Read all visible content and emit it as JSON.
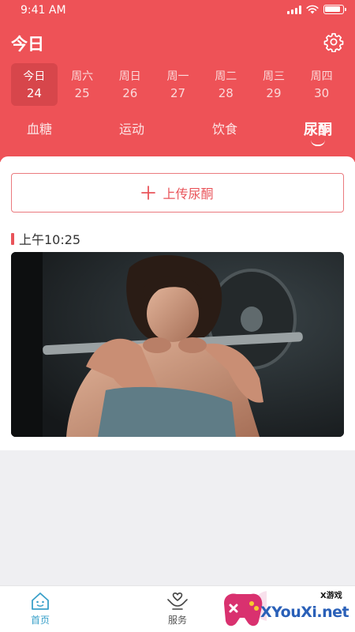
{
  "status_bar": {
    "time": "9:41 AM"
  },
  "header": {
    "title": "今日",
    "settings_icon": "gear-icon"
  },
  "days": [
    {
      "weekday": "今日",
      "date": "24",
      "active": true
    },
    {
      "weekday": "周六",
      "date": "25",
      "active": false
    },
    {
      "weekday": "周日",
      "date": "26",
      "active": false
    },
    {
      "weekday": "周一",
      "date": "27",
      "active": false
    },
    {
      "weekday": "周二",
      "date": "28",
      "active": false
    },
    {
      "weekday": "周三",
      "date": "29",
      "active": false
    },
    {
      "weekday": "周四",
      "date": "30",
      "active": false
    }
  ],
  "tabs": [
    {
      "label": "血糖",
      "active": false
    },
    {
      "label": "运动",
      "active": false
    },
    {
      "label": "饮食",
      "active": false
    },
    {
      "label": "尿酮",
      "active": true
    }
  ],
  "upload_button": {
    "label": "上传尿酮",
    "icon": "plus-icon"
  },
  "record": {
    "time": "上午10:25",
    "image": "woman lifting barbell photo"
  },
  "bottom_nav": [
    {
      "label": "首页",
      "icon": "home-icon",
      "active": true
    },
    {
      "label": "服务",
      "icon": "hands-heart-icon",
      "active": false
    }
  ],
  "watermark": {
    "text": "XYouXi.net",
    "small_text": "X游戏"
  },
  "colors": {
    "brand": "#ee5257",
    "accent_active_nav": "#3aa0c9",
    "background": "#efeff2"
  }
}
